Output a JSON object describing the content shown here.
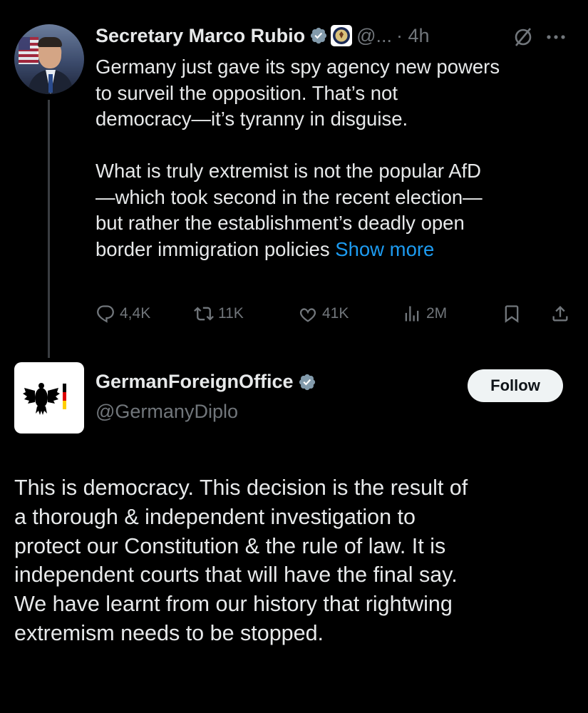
{
  "tweet1": {
    "author_name": "Secretary Marco Rubio",
    "handle": "@...",
    "time": "· 4h",
    "text_lines": [
      "Germany just gave its spy agency new powers",
      "to surveil the opposition.  That’s not",
      "democracy—it’s tyranny in disguise.",
      "",
      "What is truly extremist is not the popular AfD",
      "—which took second in the recent election—",
      "but rather the establishment’s deadly open",
      "border immigration policies"
    ],
    "show_more": "Show more",
    "stats": {
      "replies": "4,4K",
      "reposts": "11K",
      "likes": "41K",
      "views": "2M"
    }
  },
  "tweet2": {
    "author_name": "GermanForeignOffice",
    "handle": "@GermanyDiplo",
    "follow_label": "Follow",
    "text_lines": [
      "This is democracy. This decision is the result of",
      "a thorough & independent investigation to",
      "protect our Constitution & the rule of law. It is",
      "independent courts that will have the final say.",
      "We have learnt from our history that rightwing",
      "extremism needs to be stopped."
    ]
  },
  "colors": {
    "background": "#000000",
    "text": "#e7e9ea",
    "secondary": "#71767b",
    "link": "#1d9bf0",
    "verified": "#829aab"
  },
  "icons": [
    "verified-badge-icon",
    "state-department-seal-icon",
    "grok-icon",
    "more-icon",
    "reply-icon",
    "repost-icon",
    "like-icon",
    "views-icon",
    "bookmark-icon",
    "share-icon",
    "federal-eagle-logo-icon"
  ]
}
